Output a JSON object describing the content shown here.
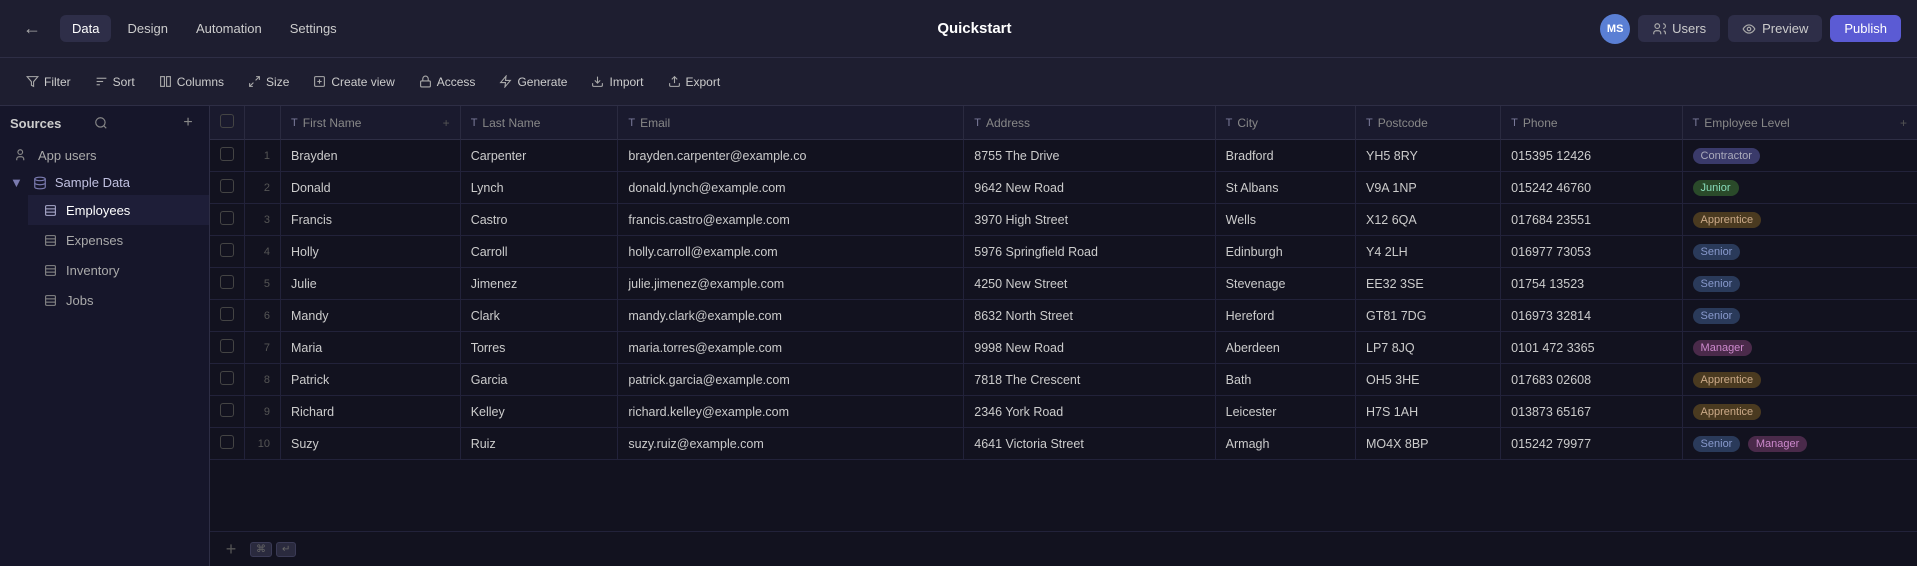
{
  "topbar": {
    "title": "Quickstart",
    "avatar_initials": "MS",
    "nav_items": [
      {
        "id": "data",
        "label": "Data",
        "active": true
      },
      {
        "id": "design",
        "label": "Design",
        "active": false
      },
      {
        "id": "automation",
        "label": "Automation",
        "active": false
      },
      {
        "id": "settings",
        "label": "Settings",
        "active": false
      }
    ],
    "btn_users": "Users",
    "btn_preview": "Preview",
    "btn_publish": "Publish"
  },
  "toolbar": {
    "filter": "Filter",
    "sort": "Sort",
    "columns": "Columns",
    "size": "Size",
    "create_view": "Create view",
    "access": "Access",
    "generate": "Generate",
    "import": "Import",
    "export": "Export"
  },
  "sidebar": {
    "sources_label": "Sources",
    "app_users_label": "App users",
    "sample_data_label": "Sample Data",
    "items": [
      {
        "id": "employees",
        "label": "Employees",
        "active": true
      },
      {
        "id": "expenses",
        "label": "Expenses",
        "active": false
      },
      {
        "id": "inventory",
        "label": "Inventory",
        "active": false
      },
      {
        "id": "jobs",
        "label": "Jobs",
        "active": false
      }
    ]
  },
  "table": {
    "columns": [
      {
        "id": "first_name",
        "label": "First Name",
        "type": "T"
      },
      {
        "id": "last_name",
        "label": "Last Name",
        "type": "T"
      },
      {
        "id": "email",
        "label": "Email",
        "type": "T"
      },
      {
        "id": "address",
        "label": "Address",
        "type": "T"
      },
      {
        "id": "city",
        "label": "City",
        "type": "T"
      },
      {
        "id": "postcode",
        "label": "Postcode",
        "type": "T"
      },
      {
        "id": "phone",
        "label": "Phone",
        "type": "T"
      },
      {
        "id": "employee_level",
        "label": "Employee Level",
        "type": "T"
      }
    ],
    "rows": [
      {
        "num": 1,
        "first_name": "Brayden",
        "last_name": "Carpenter",
        "email": "brayden.carpenter@example.co",
        "address": "8755 The Drive",
        "city": "Bradford",
        "postcode": "YH5 8RY",
        "phone": "015395 12426",
        "employee_level": "Contractor",
        "level_class": "badge-contractor"
      },
      {
        "num": 2,
        "first_name": "Donald",
        "last_name": "Lynch",
        "email": "donald.lynch@example.com",
        "address": "9642 New Road",
        "city": "St Albans",
        "postcode": "V9A 1NP",
        "phone": "015242 46760",
        "employee_level": "Junior",
        "level_class": "badge-junior"
      },
      {
        "num": 3,
        "first_name": "Francis",
        "last_name": "Castro",
        "email": "francis.castro@example.com",
        "address": "3970 High Street",
        "city": "Wells",
        "postcode": "X12 6QA",
        "phone": "017684 23551",
        "employee_level": "Apprentice",
        "level_class": "badge-apprentice"
      },
      {
        "num": 4,
        "first_name": "Holly",
        "last_name": "Carroll",
        "email": "holly.carroll@example.com",
        "address": "5976 Springfield Road",
        "city": "Edinburgh",
        "postcode": "Y4 2LH",
        "phone": "016977 73053",
        "employee_level": "Senior",
        "level_class": "badge-senior"
      },
      {
        "num": 5,
        "first_name": "Julie",
        "last_name": "Jimenez",
        "email": "julie.jimenez@example.com",
        "address": "4250 New Street",
        "city": "Stevenage",
        "postcode": "EE32 3SE",
        "phone": "01754 13523",
        "employee_level": "Senior",
        "level_class": "badge-senior"
      },
      {
        "num": 6,
        "first_name": "Mandy",
        "last_name": "Clark",
        "email": "mandy.clark@example.com",
        "address": "8632 North Street",
        "city": "Hereford",
        "postcode": "GT81 7DG",
        "phone": "016973 32814",
        "employee_level": "Senior",
        "level_class": "badge-senior"
      },
      {
        "num": 7,
        "first_name": "Maria",
        "last_name": "Torres",
        "email": "maria.torres@example.com",
        "address": "9998 New Road",
        "city": "Aberdeen",
        "postcode": "LP7 8JQ",
        "phone": "0101 472 3365",
        "employee_level": "Manager",
        "level_class": "badge-manager"
      },
      {
        "num": 8,
        "first_name": "Patrick",
        "last_name": "Garcia",
        "email": "patrick.garcia@example.com",
        "address": "7818 The Crescent",
        "city": "Bath",
        "postcode": "OH5 3HE",
        "phone": "017683 02608",
        "employee_level": "Apprentice",
        "level_class": "badge-apprentice"
      },
      {
        "num": 9,
        "first_name": "Richard",
        "last_name": "Kelley",
        "email": "richard.kelley@example.com",
        "address": "2346 York Road",
        "city": "Leicester",
        "postcode": "H7S 1AH",
        "phone": "013873 65167",
        "employee_level": "Apprentice",
        "level_class": "badge-apprentice"
      },
      {
        "num": 10,
        "first_name": "Suzy",
        "last_name": "Ruiz",
        "email": "suzy.ruiz@example.com",
        "address": "4641 Victoria Street",
        "city": "Armagh",
        "postcode": "MO4X 8BP",
        "phone": "015242 79977",
        "employee_level": "Senior",
        "level_class": "badge-senior",
        "extra_badge": "Manager",
        "extra_class": "badge-manager"
      }
    ]
  }
}
